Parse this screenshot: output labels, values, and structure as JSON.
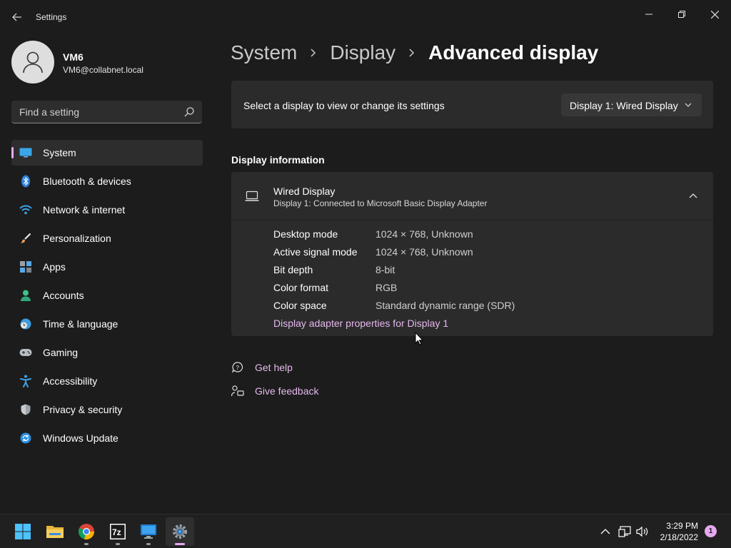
{
  "window": {
    "title": "Settings"
  },
  "user": {
    "name": "VM6",
    "email": "VM6@collabnet.local"
  },
  "search": {
    "placeholder": "Find a setting"
  },
  "sidebar": {
    "items": [
      {
        "label": "System",
        "icon": "system-icon",
        "selected": true
      },
      {
        "label": "Bluetooth & devices",
        "icon": "bluetooth-icon"
      },
      {
        "label": "Network & internet",
        "icon": "wifi-icon"
      },
      {
        "label": "Personalization",
        "icon": "brush-icon"
      },
      {
        "label": "Apps",
        "icon": "apps-icon"
      },
      {
        "label": "Accounts",
        "icon": "accounts-icon"
      },
      {
        "label": "Time & language",
        "icon": "clock-globe-icon"
      },
      {
        "label": "Gaming",
        "icon": "gamepad-icon"
      },
      {
        "label": "Accessibility",
        "icon": "accessibility-icon"
      },
      {
        "label": "Privacy & security",
        "icon": "shield-icon"
      },
      {
        "label": "Windows Update",
        "icon": "update-icon"
      }
    ]
  },
  "breadcrumb": {
    "items": [
      "System",
      "Display"
    ],
    "current": "Advanced display"
  },
  "display_select": {
    "label": "Select a display to view or change its settings",
    "value": "Display 1: Wired Display"
  },
  "display_info": {
    "section_title": "Display information",
    "title": "Wired Display",
    "subtitle": "Display 1: Connected to Microsoft Basic Display Adapter",
    "rows": [
      {
        "key": "Desktop mode",
        "value": "1024 × 768, Unknown"
      },
      {
        "key": "Active signal mode",
        "value": "1024 × 768, Unknown"
      },
      {
        "key": "Bit depth",
        "value": "8-bit"
      },
      {
        "key": "Color format",
        "value": "RGB"
      },
      {
        "key": "Color space",
        "value": "Standard dynamic range (SDR)"
      }
    ],
    "adapter_link": "Display adapter properties for Display 1"
  },
  "help": {
    "get_help": "Get help",
    "give_feedback": "Give feedback"
  },
  "taskbar": {
    "apps": [
      "start-icon",
      "file-explorer-icon",
      "chrome-icon",
      "7zip-icon",
      "remote-desktop-icon",
      "settings-icon"
    ],
    "time": "3:29 PM",
    "date": "2/18/2022",
    "notifications": "1"
  },
  "colors": {
    "accent": "#e6a8f0",
    "background": "#1c1c1c",
    "card": "#2b2b2b"
  }
}
